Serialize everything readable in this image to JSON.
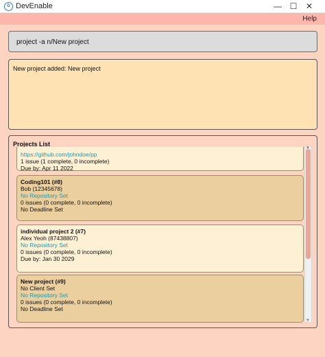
{
  "window": {
    "app_icon": "devenable-logo-icon",
    "title": "DevEnable",
    "controls": {
      "minimize": "—",
      "maximize": "☐",
      "close": "✕"
    }
  },
  "menu": {
    "help": "Help"
  },
  "command": {
    "value": "project -a n/New project"
  },
  "result": {
    "text": "New project added: New project"
  },
  "projects": {
    "title": "Projects List",
    "cards": [
      {
        "name": "",
        "owner": "",
        "repo": "https://github.com/johndoe/pp",
        "issues": "1 issue (1 complete, 0 incomplete)",
        "due": "Due by: Apr 11 2022"
      },
      {
        "name": "Coding101 (#8)",
        "owner": "Bob (12345678)",
        "repo": "No Repository Set",
        "issues": "0 issues (0 complete, 0 incomplete)",
        "due": "No Deadline Set"
      },
      {
        "name": "individual project 2 (#7)",
        "owner": "Alex Yeoh (87438807)",
        "repo": "No Repository Set",
        "issues": "0 issues (0 complete, 0 incomplete)",
        "due": "Due by: Jan 30 2029"
      },
      {
        "name": "New project (#9)",
        "owner": "No Client Set",
        "repo": "No Repository Set",
        "issues": "0 issues (0 complete, 0 incomplete)",
        "due": "No Deadline Set"
      }
    ]
  },
  "colors": {
    "background": "#fdd3c2",
    "menubar": "#fdb6ad",
    "result_bg": "#fee2b3",
    "card_light": "#fdf0d5",
    "card_dark": "#eccf9e",
    "repo_link": "#1a9bb0",
    "scroll_thumb": "#e6a898"
  }
}
